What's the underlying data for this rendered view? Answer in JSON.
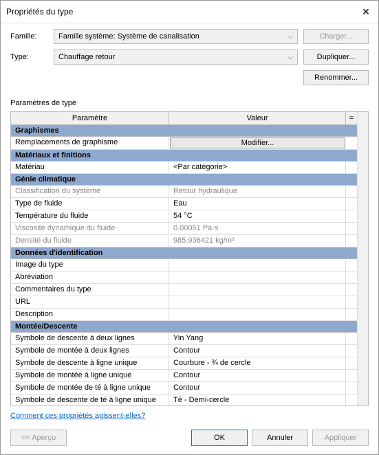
{
  "title": "Propriétés du type",
  "form": {
    "family_label": "Famille:",
    "family_value": "Famille système: Système de canalisation",
    "type_label": "Type:",
    "type_value": "Chauffage retour",
    "load_btn": "Charger...",
    "duplicate_btn": "Dupliquer...",
    "rename_btn": "Renommer..."
  },
  "section_label": "Paramètres de type",
  "grid": {
    "col_param": "Paramètre",
    "col_value": "Valeur",
    "col_eq": "=",
    "groups": [
      {
        "name": "Graphismes",
        "rows": [
          {
            "p": "Remplacements de graphisme",
            "v": "Modifier...",
            "button": true
          }
        ]
      },
      {
        "name": "Matériaux et finitions",
        "rows": [
          {
            "p": "Matériau",
            "v": "<Par catégorie>"
          }
        ]
      },
      {
        "name": "Génie climatique",
        "rows": [
          {
            "p": "Classification du système",
            "v": "Retour hydraulique",
            "disabled": true
          },
          {
            "p": "Type de fluide",
            "v": "Eau"
          },
          {
            "p": "Température du fluide",
            "v": "54 °C"
          },
          {
            "p": "Viscosité dynamique du fluide",
            "v": "0.00051 Pa·s",
            "disabled": true
          },
          {
            "p": "Densité du fluide",
            "v": "985.936421 kg/m³",
            "disabled": true
          }
        ]
      },
      {
        "name": "Données d'identification",
        "rows": [
          {
            "p": "Image du type",
            "v": ""
          },
          {
            "p": "Abréviation",
            "v": ""
          },
          {
            "p": "Commentaires du type",
            "v": ""
          },
          {
            "p": "URL",
            "v": ""
          },
          {
            "p": "Description",
            "v": ""
          }
        ]
      },
      {
        "name": "Montée/Descente",
        "rows": [
          {
            "p": "Symbole de descente à deux lignes",
            "v": "Yin Yang"
          },
          {
            "p": "Symbole de montée à deux lignes",
            "v": "Contour"
          },
          {
            "p": "Symbole de descente à ligne unique",
            "v": "Courbure - ¾ de cercle"
          },
          {
            "p": "Symbole de montée à ligne unique",
            "v": "Contour"
          },
          {
            "p": "Symbole de montée de té à ligne unique",
            "v": "Contour"
          },
          {
            "p": "Symbole de descente de té à ligne unique",
            "v": "Té - Demi-cercle"
          }
        ]
      }
    ]
  },
  "footer": {
    "link": "Comment ces propriétés agissent-elles?",
    "preview_btn": "<< Aperçu",
    "ok_btn": "OK",
    "cancel_btn": "Annuler",
    "apply_btn": "Appliquer"
  }
}
